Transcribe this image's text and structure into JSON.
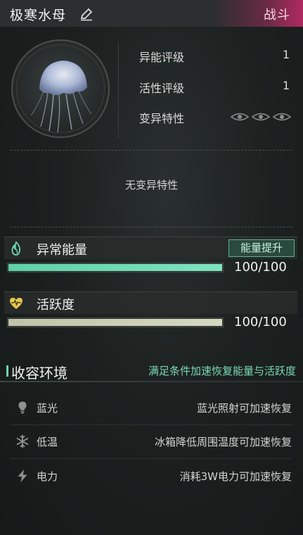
{
  "header": {
    "title": "极寒水母",
    "battle_label": "战斗"
  },
  "stats": [
    {
      "label": "异能评级",
      "value": "1"
    },
    {
      "label": "活性评级",
      "value": "1"
    },
    {
      "label": "变异特性",
      "value": ""
    }
  ],
  "mutation_eyes": [
    "eye-icon",
    "eye-icon",
    "eye-icon"
  ],
  "mutation_text": "无变异特性",
  "energy": {
    "title": "异常能量",
    "boost_label": "能量提升",
    "value_text": "100/100",
    "fill": 1.0,
    "color": "#6ad9b1"
  },
  "activity": {
    "title": "活跃度",
    "value_text": "100/100",
    "fill": 1.0,
    "color": "#d0d4bb"
  },
  "environment": {
    "title": "收容环境",
    "hint": "满足条件加速恢复能量与活跃度",
    "items": [
      {
        "icon": "bulb-icon",
        "label": "蓝光",
        "desc": "蓝光照射可加速恢复"
      },
      {
        "icon": "snowflake-icon",
        "label": "低温",
        "desc": "冰箱降低周围温度可加速恢复"
      },
      {
        "icon": "lightning-icon",
        "label": "电力",
        "desc": "消耗3W电力可加速恢复"
      }
    ]
  },
  "colors": {
    "accent": "#6fd5ae",
    "battle": "#b02a60"
  }
}
